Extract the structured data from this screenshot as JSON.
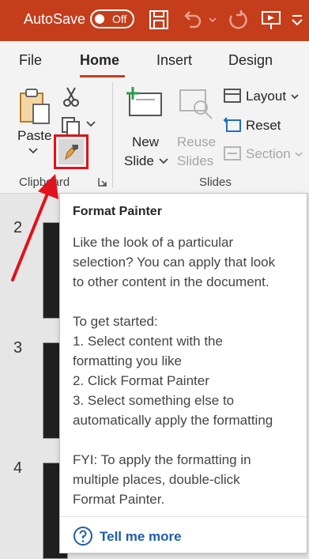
{
  "titlebar": {
    "autosave_label": "AutoSave",
    "autosave_state": "Off",
    "icons": [
      "save-icon",
      "undo-icon",
      "redo-icon",
      "present-icon",
      "customize-icon"
    ],
    "color": "#c43e1c"
  },
  "ribbon": {
    "tabs": [
      {
        "label": "File",
        "active": false
      },
      {
        "label": "Home",
        "active": true
      },
      {
        "label": "Insert",
        "active": false
      },
      {
        "label": "Design",
        "active": false
      }
    ],
    "clipboard": {
      "paste_label": "Paste",
      "group_label": "Clipboard"
    },
    "slides": {
      "new_slide_line1": "New",
      "new_slide_line2": "Slide",
      "reuse_line1": "Reuse",
      "reuse_line2": "Slides",
      "layout_label": "Layout",
      "reset_label": "Reset",
      "section_label": "Section",
      "group_label": "Slides"
    }
  },
  "slides_panel": {
    "numbers": [
      "2",
      "3",
      "4"
    ]
  },
  "tooltip": {
    "title": "Format Painter",
    "lines": [
      "Like the look of a particular",
      "selection? You can apply that look",
      "to other content in the document.",
      "",
      "To get started:",
      "1. Select content with the",
      "formatting you like",
      "2. Click Format Painter",
      "3. Select something else to",
      "automatically apply the formatting",
      "",
      "FYI: To apply the formatting in",
      "multiple places, double-click",
      "Format Painter."
    ],
    "more_label": "Tell me more",
    "link_color": "#1f5da8"
  },
  "annotation": {
    "highlight_color": "#e0121b"
  }
}
